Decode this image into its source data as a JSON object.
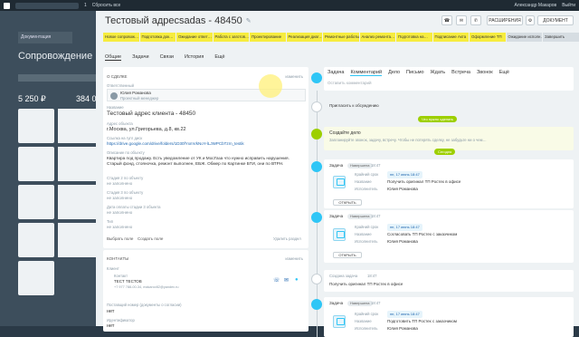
{
  "topbar": {
    "tab_text": "Сделки",
    "count": "1",
    "sync": "Сбросить все",
    "user": "Александр Макаров",
    "exit": "Выйти"
  },
  "background": {
    "tab": "Документация",
    "title": "Сопровождение МСК",
    "val1": "5 250 ₽",
    "val2": "384 0"
  },
  "header": {
    "title": "Тестовый адресsadas - 48450",
    "btn_expand": "РАСШИРЕНИЯ",
    "btn_doc": "ДОКУМЕНТ"
  },
  "stages": [
    {
      "label": "Новое сопровож…",
      "done": true
    },
    {
      "label": "Подготовка док…",
      "done": true
    },
    {
      "label": "Ожидание ответ…",
      "done": true
    },
    {
      "label": "Работа с заготов…",
      "done": true
    },
    {
      "label": "Проектирование",
      "done": true
    },
    {
      "label": "Реализация диаг…",
      "done": true
    },
    {
      "label": "Ремонтные работы",
      "done": true
    },
    {
      "label": "Анализ ремонта…",
      "done": true
    },
    {
      "label": "Подготовка на…",
      "done": true
    },
    {
      "label": "Подписание Акта",
      "done": true
    },
    {
      "label": "Оформление ТП",
      "done": true
    },
    {
      "label": "Ожидание исполн…",
      "done": false
    },
    {
      "label": "Завершить",
      "done": false
    }
  ],
  "tabs": [
    "Общие",
    "Задачи",
    "Связи",
    "История",
    "Ещё"
  ],
  "about": {
    "header": "О СДЕЛКЕ",
    "change": "изменить",
    "responsible_label": "Ответственный",
    "responsible_name": "Юлия Романова",
    "responsible_role": "Проектный менеджер",
    "name_label": "Название",
    "name_value": "Тестовый адрес клиента - 48450",
    "addr_label": "Адрес объекта",
    "addr_value": "г.Москва, ул.Григорьева, д.8, кв.22",
    "link_label": "Ссылка на гугл диск",
    "link_value": "https://drive.google.com/drive/folders/1D30fYxmVkNoY-lLJWPCbTzrn_testik",
    "desc_label": "Описание по объекту",
    "desc_value": "Квартира под продажу. Есть уведомление от УК и МосГаза что нужно исправить нарушения. Старый фонд, стояночка, ремонт выполнен, ЕБЖ. Обмер по Картинке БТИ, они по ВТРН.",
    "stage2_label": "Стадия 2 по объекту",
    "stage2_value": "не заполнено",
    "stage3_label": "Стадия 3 по объекту",
    "stage3_value": "не заполнено",
    "date_label": "Дата оплаты стадии 3 объекта",
    "date_value": "не заполнено",
    "tip_label": "Тип",
    "tip_value": "не заполнено",
    "choose_field": "Выбрать поле",
    "create_field": "Создать поле",
    "delete_section": "Удалить раздел"
  },
  "contacts": {
    "header": "КОНТАКТЫ",
    "change": "изменить",
    "client_label": "Клиент",
    "client_sub": "Контакт",
    "client_name": "ТЕСТ ТЕСТОВ",
    "client_info": "+7 977 788-00-34, makarov82@yandex.ru",
    "consent_label": "Поставщий номер (документы о согласии)",
    "consent_value": "нет",
    "ident_label": "Идентификатор",
    "ident_value": "нет"
  },
  "right_tabs": [
    "Задача",
    "Комментарий",
    "Дело",
    "Письмо",
    "Ждать",
    "Встреча",
    "Звонок",
    "Ещё"
  ],
  "comment_placeholder": "Оставить комментарий",
  "invite": "Пригласить к обсуждению",
  "pill_planned": "Что нужно сделать",
  "created": {
    "title": "Создайте дело",
    "text": "Запланируйте звонок, задачу, встречу. Чтобы не потерять сделку, не забудьте ни о чем…",
    "pill": "Сегодня"
  },
  "tasks": [
    {
      "type": "Задача",
      "status": "Навершена",
      "time": "18:47",
      "deadline_label": "Крайний срок",
      "deadline": "пн, 17 июнь 18:47",
      "name_label": "Название",
      "name": "Получить оригинал ТП Ростех в офисе",
      "resp_label": "Исполнитель",
      "resp": "Юлия Романова",
      "btn": "ОТКРЫТЬ"
    },
    {
      "type": "Задача",
      "status": "Навершена",
      "time": "18:47",
      "deadline_label": "Крайний срок",
      "deadline": "пн, 17 июнь 18:47",
      "name_label": "Название",
      "name": "Согласовать ТП Ростех с заказчиком",
      "resp_label": "Исполнитель",
      "resp": "Юлия Романова",
      "btn": "ОТКРЫТЬ"
    },
    {
      "type": "Задача",
      "status": "Навершена",
      "time": "18:47",
      "deadline_label": "Крайний срок",
      "deadline": "пн, 17 июнь 18:47",
      "name_label": "Название",
      "name": "Подготовить ТП Ростех с заказчиком",
      "resp_label": "Исполнитель",
      "resp": "Юлия Романова",
      "btn": "ОТКРЫТЬ"
    }
  ],
  "created_task": {
    "label": "Создана задача",
    "time": "18:47",
    "text": "Получить оригинал ТП Ростех в офисе"
  }
}
